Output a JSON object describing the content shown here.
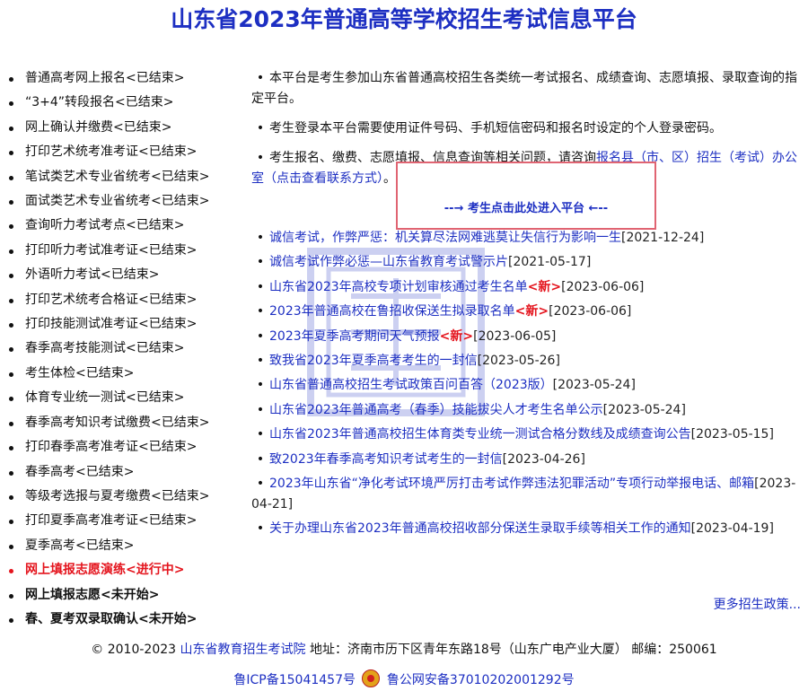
{
  "page": {
    "title": "山东省2023年普通高等学校招生考试信息平台"
  },
  "left_menu": [
    {
      "label": "普通高考网上报名<已结束>"
    },
    {
      "label": "“3+4”转段报名<已结束>"
    },
    {
      "label": "网上确认并缴费<已结束>"
    },
    {
      "label": "打印艺术统考准考证<已结束>"
    },
    {
      "label": "笔试类艺术专业省统考<已结束>"
    },
    {
      "label": "面试类艺术专业省统考<已结束>"
    },
    {
      "label": "查询听力考试考点<已结束>"
    },
    {
      "label": "打印听力考试准考证<已结束>"
    },
    {
      "label": "外语听力考试<已结束>"
    },
    {
      "label": "打印艺术统考合格证<已结束>"
    },
    {
      "label": "打印技能测试准考证<已结束>"
    },
    {
      "label": "春季高考技能测试<已结束>"
    },
    {
      "label": "考生体检<已结束>"
    },
    {
      "label": "体育专业统一测试<已结束>"
    },
    {
      "label": "春季高考知识考试缴费<已结束>"
    },
    {
      "label": "打印春季高考准考证<已结束>"
    },
    {
      "label": "春季高考<已结束>"
    },
    {
      "label": "等级考选报与夏考缴费<已结束>"
    },
    {
      "label": "打印夏季高考准考证<已结束>"
    },
    {
      "label": "夏季高考<已结束>"
    },
    {
      "label": "网上填报志愿演练<进行中>",
      "state": "active"
    },
    {
      "label": "网上填报志愿<未开始>",
      "state": "bold"
    },
    {
      "label": "春、夏考双录取确认<未开始>",
      "state": "bold"
    }
  ],
  "info": {
    "p1": "本平台是考生参加山东省普通高校招生各类统一考试报名、成绩查询、志愿填报、录取查询的指定平台。",
    "p2": "考生登录本平台需要使用证件号码、手机短信密码和报名时设定的个人登录密码。",
    "p3_prefix": "考生报名、缴费、志愿填报、信息查询等相关问题，请咨询",
    "p3_link": "报名县（市、区）招生（考试）办公室（点击查看联系方式）",
    "p3_suffix": "。",
    "enter": "--→ 考生点击此处进入平台 ←--"
  },
  "news": [
    {
      "title": "诚信考试，作弊严惩：机关算尽法网难逃莫让失信行为影响一生",
      "date": "[2021-12-24]"
    },
    {
      "title": "诚信考试作弊必惩—山东省教育考试警示片",
      "date": "[2021-05-17]"
    },
    {
      "title": "山东省2023年高校专项计划审核通过考生名单",
      "new": "<新>",
      "date": "[2023-06-06]"
    },
    {
      "title": "2023年普通高校在鲁招收保送生拟录取名单",
      "new": "<新>",
      "date": "[2023-06-06]"
    },
    {
      "title": "2023年夏季高考期间天气预报",
      "new": "<新>",
      "date": "[2023-06-05]"
    },
    {
      "title": "致我省2023年夏季高考考生的一封信",
      "date": "[2023-05-26]"
    },
    {
      "title": "山东省普通高校招生考试政策百问百答（2023版）",
      "date": "[2023-05-24]"
    },
    {
      "title": "山东省2023年普通高考（春季）技能拔尖人才考生名单公示",
      "date": "[2023-05-24]"
    },
    {
      "title": "山东省2023年普通高校招生体育类专业统一测试合格分数线及成绩查询公告",
      "date": "[2023-05-15]"
    },
    {
      "title": "致2023年春季高考知识考试考生的一封信",
      "date": "[2023-04-26]"
    },
    {
      "title": "2023年山东省“净化考试环境严厉打击考试作弊违法犯罪活动”专项行动举报电话、邮箱",
      "date": "[2023-04-21]"
    },
    {
      "title": "关于办理山东省2023年普通高校招收部分保送生录取手续等相关工作的通知",
      "date": "[2023-04-19]"
    }
  ],
  "more": "更多招生政策...",
  "footer": {
    "copyright": "© 2010-2023",
    "org": "山东省教育招生考试院",
    "address": "地址：济南市历下区青年东路18号（山东广电产业大厦）   邮编：250061",
    "icp": "鲁ICP备15041457号",
    "police": "鲁公网安备37010202001292号"
  }
}
